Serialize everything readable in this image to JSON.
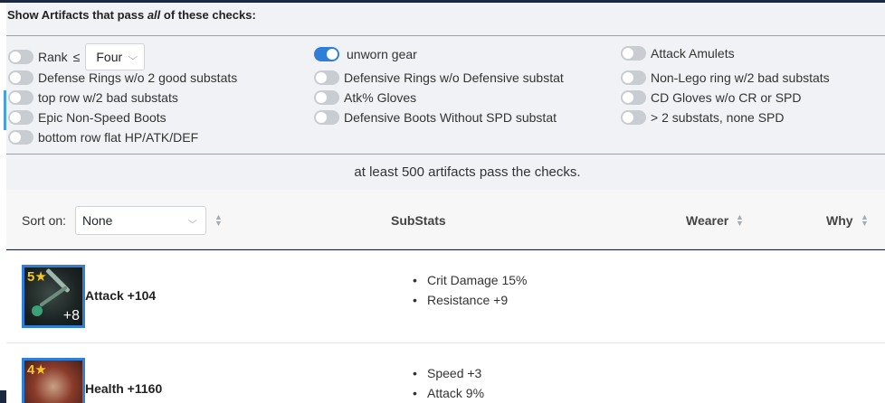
{
  "filter": {
    "title_pre": "Show Artifacts that pass ",
    "title_em": "all",
    "title_post": " of these checks:",
    "rank": {
      "label": "Rank",
      "le": "≤",
      "value": "Four"
    },
    "checks_col1": [
      "Defense Rings w/o 2 good substats",
      "top row w/2 bad substats",
      "Epic Non-Speed Boots",
      "bottom row flat HP/ATK/DEF"
    ],
    "checks_col2": [
      "unworn gear",
      "Defensive Rings w/o Defensive substat",
      "Atk% Gloves",
      "Defensive Boots Without SPD substat"
    ],
    "checks_col3": [
      "Attack Amulets",
      "Non-Lego ring w/2 bad substats",
      "CD Gloves w/o CR or SPD",
      "> 2 substats, none SPD"
    ],
    "pass_count": "at least 500 artifacts pass the checks."
  },
  "table": {
    "sort_label": "Sort on:",
    "sort_value": "None",
    "col_substats": "SubStats",
    "col_wearer": "Wearer",
    "col_why": "Why"
  },
  "rows": [
    {
      "stars": "5★",
      "plus": "+8",
      "main": "Attack +104",
      "subs": [
        "Crit Damage 15%",
        "Resistance +9"
      ]
    },
    {
      "stars": "4★",
      "plus": "",
      "main": "Health +1160",
      "subs": [
        "Speed +3",
        "Attack 9%"
      ]
    }
  ],
  "colors": {
    "accent": "#2f7fd8",
    "panel": "#f0f2f5",
    "star": "#f3c623"
  }
}
